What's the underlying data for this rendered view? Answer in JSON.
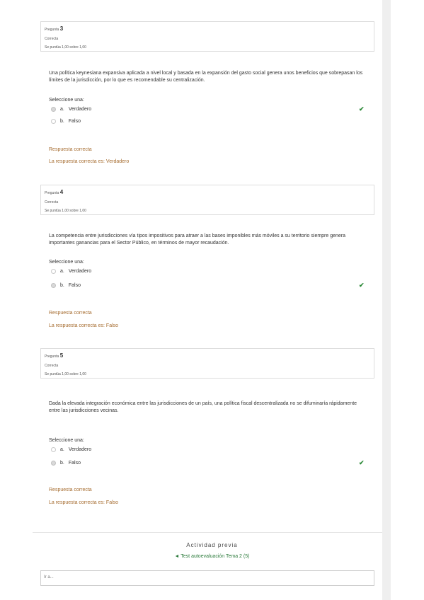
{
  "questions": [
    {
      "label": "Pregunta",
      "number": "3",
      "state": "Correcta",
      "grade": "Se puntúa 1,00 sobre 1,00",
      "text": "Una política keynesiana expansiva aplicada a nivel local y basada en la expansión del gasto social genera unos beneficios que sobrepasan los límites de la jurisdicción, por lo que es recomendable su centralización.",
      "prompt": "Seleccione una:",
      "options": [
        {
          "letter": "a.",
          "label": "Verdadero",
          "selected": true
        },
        {
          "letter": "b.",
          "label": "Falso",
          "selected": false
        }
      ],
      "feedback_status": "Respuesta correcta",
      "feedback_answer": "La respuesta correcta es: Verdadero"
    },
    {
      "label": "Pregunta",
      "number": "4",
      "state": "Correcta",
      "grade": "Se puntúa 1,00 sobre 1,00",
      "text": "La competencia entre jurisdicciones vía tipos impositivos para atraer a las bases imponibles más móviles a su territorio siempre genera importantes ganancias para el Sector Público, en términos de mayor recaudación.",
      "prompt": "Seleccione una:",
      "options": [
        {
          "letter": "a.",
          "label": "Verdadero",
          "selected": false
        },
        {
          "letter": "b.",
          "label": "Falso",
          "selected": true
        }
      ],
      "feedback_status": "Respuesta correcta",
      "feedback_answer": "La respuesta correcta es: Falso"
    },
    {
      "label": "Pregunta",
      "number": "5",
      "state": "Correcta",
      "grade": "Se puntúa 1,00 sobre 1,00",
      "text": "Dada la elevada integración económica entre las jurisdicciones de un país, una política fiscal descentralizada no se difuminaría rápidamente entre las jurisdicciones vecinas.",
      "prompt": "Seleccione una:",
      "options": [
        {
          "letter": "a.",
          "label": "Verdadero",
          "selected": false
        },
        {
          "letter": "b.",
          "label": "Falso",
          "selected": true
        }
      ],
      "feedback_status": "Respuesta correcta",
      "feedback_answer": "La respuesta correcta es: Falso"
    }
  ],
  "check_icon": "✔",
  "nav": {
    "heading": "Actividad previa",
    "prev_link": "◄ Test autoevaluación Tema 2 (5)",
    "jump_placeholder": "Ir a..."
  },
  "colors": {
    "feedback": "#a56b2e",
    "check": "#2e8b3a",
    "link": "#2a7a3a"
  }
}
